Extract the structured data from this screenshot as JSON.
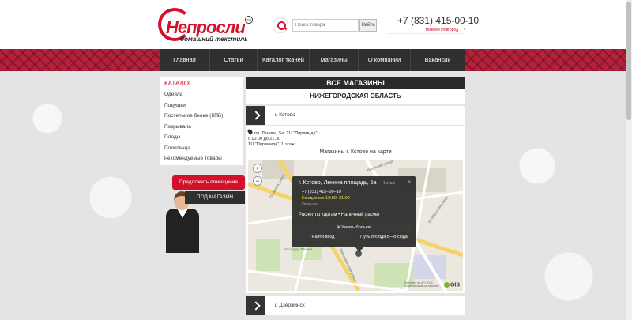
{
  "header": {
    "logo_text": "Непросли",
    "logo_sub": "домашний текстиль",
    "logo_tm": "TM",
    "search_placeholder": "Поиск товара",
    "search_button": "Найти",
    "phone": "+7 (831) 415-00-10",
    "city": "Нижний Новгород"
  },
  "nav": {
    "items": [
      {
        "label": "Главная"
      },
      {
        "label": "Статьи"
      },
      {
        "label": "Каталог тканей"
      },
      {
        "label": "Магазины"
      },
      {
        "label": "О компании"
      },
      {
        "label": "Вакансии"
      }
    ]
  },
  "catalog": {
    "title": "КАТАЛОГ",
    "items": [
      {
        "label": "Одеяла"
      },
      {
        "label": "Подушки"
      },
      {
        "label": "Постельное белье (КПБ)"
      },
      {
        "label": "Покрывала"
      },
      {
        "label": "Пледы"
      },
      {
        "label": "Полотенца"
      },
      {
        "label": "Рекомендуемые товары"
      }
    ]
  },
  "promo": {
    "label1": "Предложить помещение",
    "label2": "ПОД МАГАЗИН"
  },
  "main": {
    "title": "ВСЕ МАГАЗИНЫ",
    "region": "НИЖЕГОРОДСКАЯ ОБЛАСТЬ",
    "city1": "г. Кстово",
    "city2": "г. Дзержинск",
    "address_line1": "пл. Ленина, 5а. ТЦ \"Пирамида\"",
    "address_line2": "с 10.00 до 21.00",
    "address_line3": "ТЦ \"Пирамида\", 1 этаж.",
    "map_caption": "Магазины г. Кстово на карте"
  },
  "map": {
    "popup_title": "г. Кстово, Ленина площадь, 5а",
    "popup_dist": "— 1 этаж",
    "popup_close": "×",
    "popup_phone": "+7 (831) 415–00–10",
    "popup_hours": "Ежедневно 10:00–21:00",
    "popup_status": "Открыто",
    "popup_pay": "Расчет по картам • Наличный расчет",
    "popup_more": "⊕ Узнать больше",
    "popup_find": "Найти вход",
    "popup_route": "Путь отсюда  о—о  сюда",
    "street1": "Парковая улица",
    "street2": "Школьная улица",
    "street3": "площадь Ленина",
    "street4": "Магистральная улица",
    "street5": "Октябрьская улица",
    "copyright1": "Работает на API 2ГИС",
    "copyright2": "Лицензионное соглашение",
    "gis": "GIS"
  },
  "colors": {
    "accent": "#d2112c",
    "dark": "#2f2f2f"
  }
}
